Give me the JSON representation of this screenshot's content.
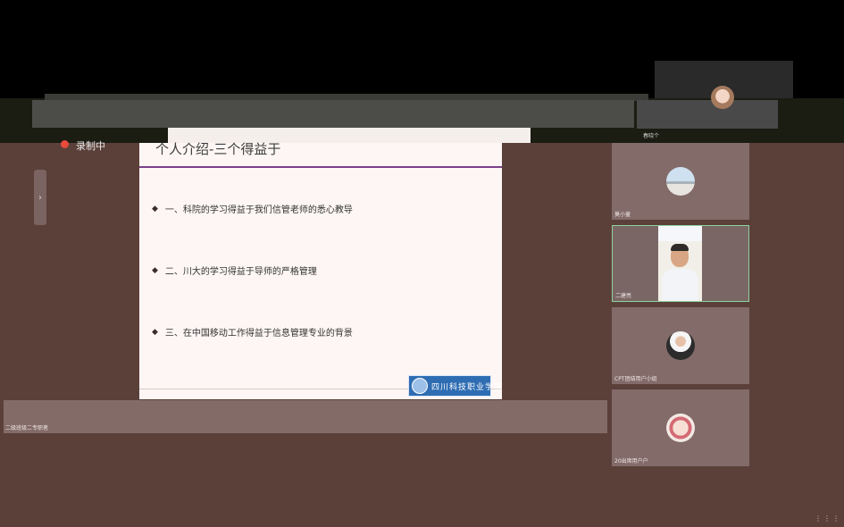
{
  "recording": {
    "label": "录制中"
  },
  "side_handle": {
    "glyph": "›"
  },
  "slide": {
    "title": "个人介绍-三个得益于",
    "bullets": [
      "一、科院的学习得益于我们信管老师的悉心教导",
      "二、川大的学习得益于导师的严格管理",
      "三、在中国移动工作得益于信息管理专业的背景"
    ],
    "bullet_glyph": "◆",
    "logo_text": "四川科技职业学院"
  },
  "banner": {
    "label": "二级班级二专职者"
  },
  "top_tile": {
    "name": "春晓个"
  },
  "participants": [
    {
      "name": "莫小童",
      "avatar": "landscape-avatar"
    },
    {
      "name": "二建亮",
      "avatar": "video-feed"
    },
    {
      "name": "CPT团结用户小组",
      "avatar": "person-avatar"
    },
    {
      "name": "20出席用户户",
      "avatar": "cartoon-avatar"
    }
  ],
  "corner": {
    "glyph": "⋮⋮⋮⋮"
  },
  "colors": {
    "accent_rule": "#7b3f89",
    "background": "#5b403a",
    "tile": "#826b69",
    "record": "#e84b3c"
  }
}
